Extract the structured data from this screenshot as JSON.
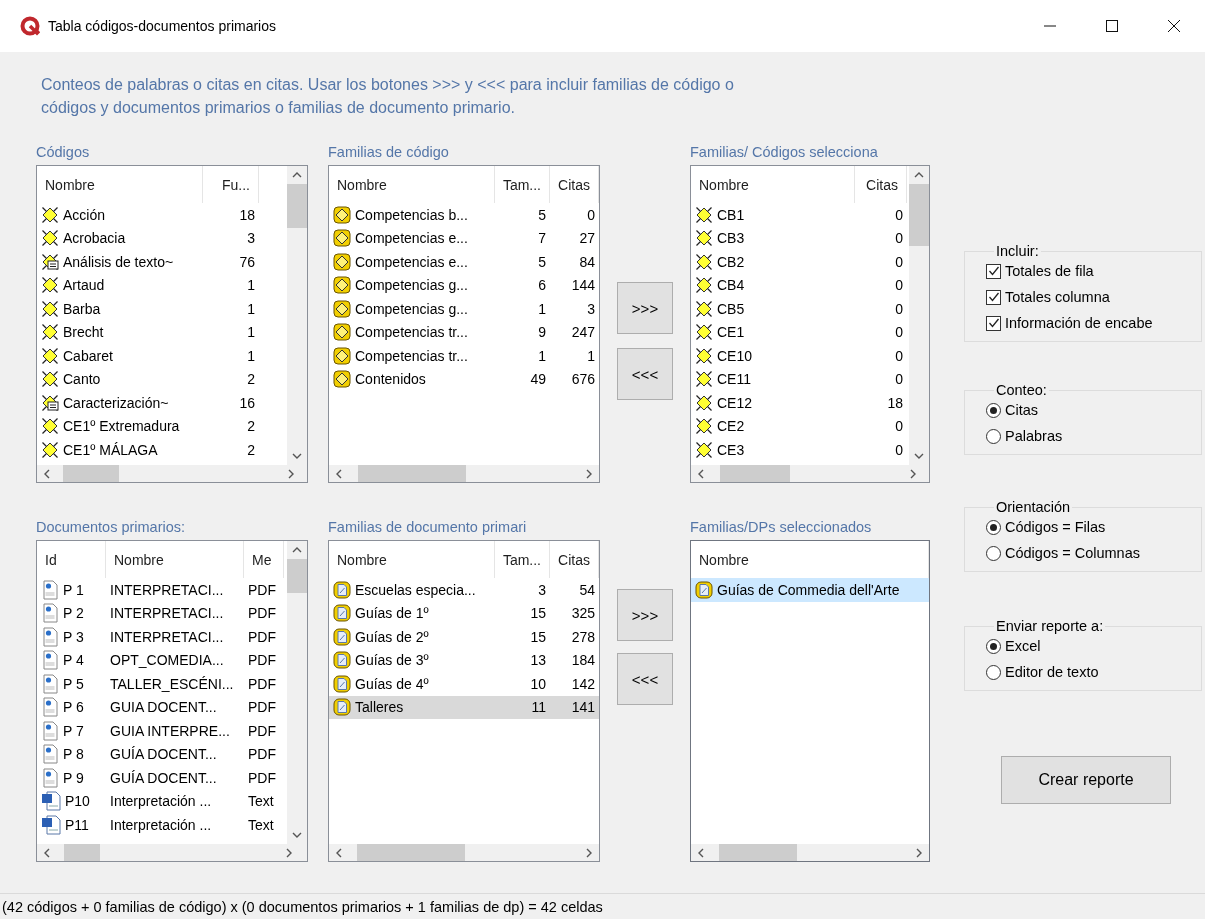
{
  "window": {
    "title": "Tabla códigos-documentos primarios"
  },
  "instructions": "Conteos de palabras o citas en citas. Usar los botones >>> y <<< para incluir familias de código o códigos y documentos primarios o familias de documento primario.",
  "lists": [
    {
      "label": "Códigos",
      "focused": false,
      "columns": [
        {
          "label": "Nombre"
        },
        {
          "label": "Fu..."
        }
      ],
      "rows": [
        {
          "kind": "code",
          "cells": [
            "Acción",
            "18"
          ],
          "selected": false
        },
        {
          "kind": "code",
          "cells": [
            "Acrobacia",
            "3"
          ],
          "selected": false
        },
        {
          "kind": "code_memo",
          "cells": [
            "Análisis de texto~",
            "76"
          ],
          "selected": false
        },
        {
          "kind": "code",
          "cells": [
            "Artaud",
            "1"
          ],
          "selected": false
        },
        {
          "kind": "code",
          "cells": [
            "Barba",
            "1"
          ],
          "selected": false
        },
        {
          "kind": "code",
          "cells": [
            "Brecht",
            "1"
          ],
          "selected": false
        },
        {
          "kind": "code",
          "cells": [
            "Cabaret",
            "1"
          ],
          "selected": false
        },
        {
          "kind": "code",
          "cells": [
            "Canto",
            "2"
          ],
          "selected": false
        },
        {
          "kind": "code_memo",
          "cells": [
            "Caracterización~",
            "16"
          ],
          "selected": false
        },
        {
          "kind": "code",
          "cells": [
            "CE1º Extremadura",
            "2"
          ],
          "selected": false
        },
        {
          "kind": "code",
          "cells": [
            "CE1º MÁLAGA",
            "2"
          ],
          "selected": false
        }
      ]
    },
    {
      "label": "Familias de código",
      "focused": false,
      "columns": [
        {
          "label": "Nombre"
        },
        {
          "label": "Tam..."
        },
        {
          "label": "Citas"
        }
      ],
      "rows": [
        {
          "kind": "code_family",
          "cells": [
            "Competencias b...",
            "5",
            "0"
          ],
          "selected": false
        },
        {
          "kind": "code_family",
          "cells": [
            "Competencias e...",
            "7",
            "27"
          ],
          "selected": false
        },
        {
          "kind": "code_family",
          "cells": [
            "Competencias e...",
            "5",
            "84"
          ],
          "selected": false
        },
        {
          "kind": "code_family",
          "cells": [
            "Competencias g...",
            "6",
            "144"
          ],
          "selected": false
        },
        {
          "kind": "code_family",
          "cells": [
            "Competencias g...",
            "1",
            "3"
          ],
          "selected": false
        },
        {
          "kind": "code_family",
          "cells": [
            "Competencias tr...",
            "9",
            "247"
          ],
          "selected": false
        },
        {
          "kind": "code_family",
          "cells": [
            "Competencias tr...",
            "1",
            "1"
          ],
          "selected": false
        },
        {
          "kind": "code_family",
          "cells": [
            "Contenidos",
            "49",
            "676"
          ],
          "selected": false
        }
      ]
    },
    {
      "label": "Familias/ Códigos selecciona",
      "focused": false,
      "columns": [
        {
          "label": "Nombre"
        },
        {
          "label": "Citas"
        }
      ],
      "rows": [
        {
          "kind": "code",
          "cells": [
            "CB1",
            "0"
          ],
          "selected": false
        },
        {
          "kind": "code",
          "cells": [
            "CB3",
            "0"
          ],
          "selected": false
        },
        {
          "kind": "code",
          "cells": [
            "CB2",
            "0"
          ],
          "selected": false
        },
        {
          "kind": "code",
          "cells": [
            "CB4",
            "0"
          ],
          "selected": false
        },
        {
          "kind": "code",
          "cells": [
            "CB5",
            "0"
          ],
          "selected": false
        },
        {
          "kind": "code",
          "cells": [
            "CE1",
            "0"
          ],
          "selected": false
        },
        {
          "kind": "code",
          "cells": [
            "CE10",
            "0"
          ],
          "selected": false
        },
        {
          "kind": "code",
          "cells": [
            "CE11",
            "0"
          ],
          "selected": false
        },
        {
          "kind": "code",
          "cells": [
            "CE12",
            "18"
          ],
          "selected": false
        },
        {
          "kind": "code",
          "cells": [
            "CE2",
            "0"
          ],
          "selected": false
        },
        {
          "kind": "code",
          "cells": [
            "CE3",
            "0"
          ],
          "selected": false
        }
      ]
    },
    {
      "label": "Documentos primarios:",
      "focused": false,
      "columns": [
        {
          "label": "Id"
        },
        {
          "label": "Nombre"
        },
        {
          "label": "Me"
        }
      ],
      "rows": [
        {
          "kind": "pdf",
          "cells": [
            "P 1",
            "INTERPRETACI...",
            "PDF"
          ],
          "selected": false
        },
        {
          "kind": "pdf",
          "cells": [
            "P 2",
            "INTERPRETACI...",
            "PDF"
          ],
          "selected": false
        },
        {
          "kind": "pdf",
          "cells": [
            "P 3",
            "INTERPRETACI...",
            "PDF"
          ],
          "selected": false
        },
        {
          "kind": "pdf",
          "cells": [
            "P 4",
            "OPT_COMEDIA...",
            "PDF"
          ],
          "selected": false
        },
        {
          "kind": "pdf",
          "cells": [
            "P 5",
            "TALLER_ESCÉNI...",
            "PDF"
          ],
          "selected": false
        },
        {
          "kind": "pdf",
          "cells": [
            "P 6",
            "GUIA DOCENT...",
            "PDF"
          ],
          "selected": false
        },
        {
          "kind": "pdf",
          "cells": [
            "P 7",
            "GUIA INTERPRE...",
            "PDF"
          ],
          "selected": false
        },
        {
          "kind": "pdf",
          "cells": [
            "P 8",
            "GUÍA DOCENT...",
            "PDF"
          ],
          "selected": false
        },
        {
          "kind": "pdf",
          "cells": [
            "P 9",
            "GUÍA DOCENT...",
            "PDF"
          ],
          "selected": false
        },
        {
          "kind": "word",
          "cells": [
            "P10",
            "Interpretación ...",
            "Text"
          ],
          "selected": false
        },
        {
          "kind": "word",
          "cells": [
            "P11",
            "Interpretación ...",
            "Text"
          ],
          "selected": false
        }
      ]
    },
    {
      "label": "Familias de documento primari",
      "focused": false,
      "columns": [
        {
          "label": "Nombre"
        },
        {
          "label": "Tam..."
        },
        {
          "label": "Citas"
        }
      ],
      "rows": [
        {
          "kind": "doc_family",
          "cells": [
            "Escuelas especia...",
            "3",
            "54"
          ],
          "selected": false
        },
        {
          "kind": "doc_family",
          "cells": [
            "Guías de 1º",
            "15",
            "325"
          ],
          "selected": false
        },
        {
          "kind": "doc_family",
          "cells": [
            "Guías de 2º",
            "15",
            "278"
          ],
          "selected": false
        },
        {
          "kind": "doc_family",
          "cells": [
            "Guías de 3º",
            "13",
            "184"
          ],
          "selected": false
        },
        {
          "kind": "doc_family",
          "cells": [
            "Guías de 4º",
            "10",
            "142"
          ],
          "selected": false
        },
        {
          "kind": "doc_family",
          "cells": [
            "Talleres",
            "11",
            "141"
          ],
          "selected": true
        }
      ]
    },
    {
      "label": "Familias/DPs seleccionados",
      "focused": true,
      "columns": [
        {
          "label": "Nombre"
        }
      ],
      "rows": [
        {
          "kind": "doc_family",
          "cells": [
            "Guías de Commedia dell'Arte"
          ],
          "selected": true
        }
      ]
    }
  ],
  "transfer_buttons": [
    {
      "add": ">>>",
      "remove": "<<<"
    },
    {
      "add": ">>>",
      "remove": "<<<"
    }
  ],
  "groups": [
    {
      "kind": "checkbox",
      "label": "Incluir:",
      "options": [
        {
          "label": "Totales de fila",
          "checked": true
        },
        {
          "label": "Totales columna",
          "checked": true
        },
        {
          "label": "Información de encabe",
          "checked": true
        }
      ]
    },
    {
      "kind": "radio",
      "label": "Conteo:",
      "options": [
        {
          "label": "Citas",
          "selected": true
        },
        {
          "label": "Palabras",
          "selected": false
        }
      ]
    },
    {
      "kind": "radio",
      "label": "Orientación",
      "options": [
        {
          "label": "Códigos = Filas",
          "selected": true
        },
        {
          "label": "Códigos = Columnas",
          "selected": false
        }
      ]
    },
    {
      "kind": "radio",
      "label": "Enviar reporte a:",
      "options": [
        {
          "label": "Excel",
          "selected": true
        },
        {
          "label": "Editor de texto",
          "selected": false
        }
      ]
    }
  ],
  "create_button": "Crear reporte",
  "status_bar": "(42 códigos + 0 familias de código) x (0 documentos primarios + 1 familias de dp) = 42 celdas"
}
